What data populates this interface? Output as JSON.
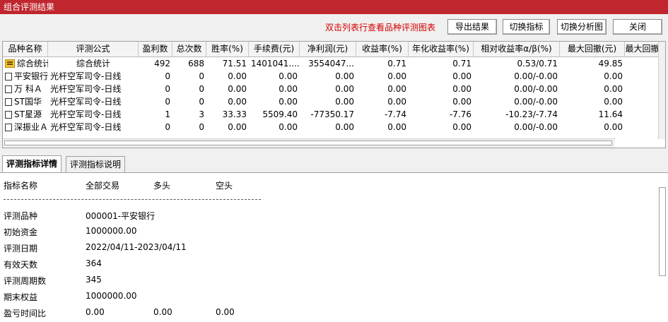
{
  "window": {
    "title": "组合评测结果"
  },
  "toolbar": {
    "hint": "双击列表行查看品种评测图表",
    "export_label": "导出结果",
    "switch_indicator_label": "切换指标",
    "switch_chart_label": "切换分析图",
    "close_label": "关闭"
  },
  "table": {
    "columns": [
      "品种名称",
      "评测公式",
      "盈利数",
      "总次数",
      "胜率(%)",
      "手续费(元)",
      "净利润(元)",
      "收益率(%)",
      "年化收益率(%)",
      "相对收益率α/β(%)",
      "最大回撤(元)",
      "最大回撤"
    ],
    "rows": [
      [
        "综合统计",
        "综合统计",
        "492",
        "688",
        "71.51",
        "1401041....",
        "3554047...",
        "0.71",
        "0.71",
        "0.53/0.71",
        "49.85",
        ""
      ],
      [
        "平安银行",
        "光杆空军司令-日线",
        "0",
        "0",
        "0.00",
        "0.00",
        "0.00",
        "0.00",
        "0.00",
        "0.00/-0.00",
        "0.00",
        ""
      ],
      [
        "万 科Ａ",
        "光杆空军司令-日线",
        "0",
        "0",
        "0.00",
        "0.00",
        "0.00",
        "0.00",
        "0.00",
        "0.00/-0.00",
        "0.00",
        ""
      ],
      [
        "ST国华",
        "光杆空军司令-日线",
        "0",
        "0",
        "0.00",
        "0.00",
        "0.00",
        "0.00",
        "0.00",
        "0.00/-0.00",
        "0.00",
        ""
      ],
      [
        "ST星源",
        "光杆空军司令-日线",
        "1",
        "3",
        "33.33",
        "5509.40",
        "-77350.17",
        "-7.74",
        "-7.76",
        "-10.23/-7.74",
        "11.64",
        ""
      ],
      [
        "深振业Ａ",
        "光杆空军司令-日线",
        "0",
        "0",
        "0.00",
        "0.00",
        "0.00",
        "0.00",
        "0.00",
        "0.00/-0.00",
        "0.00",
        ""
      ]
    ]
  },
  "tabs": [
    {
      "label": "评测指标详情"
    },
    {
      "label": "评测指标说明"
    }
  ],
  "detail": {
    "headers": [
      "指标名称",
      "全部交易",
      "多头",
      "空头"
    ],
    "divider": "------------------------------------------------------------",
    "rows": [
      [
        "评测品种",
        "000001-平安银行",
        "",
        ""
      ],
      [
        "初始资金",
        "1000000.00",
        "",
        ""
      ],
      [
        "评测日期",
        "2022/04/11-2023/04/11",
        "",
        ""
      ],
      [
        "有效天数",
        "364",
        "",
        ""
      ],
      [
        "评测周期数",
        " 345",
        "",
        ""
      ],
      [
        "期末权益",
        "1000000.00",
        "",
        ""
      ],
      [
        "盈亏时间比",
        " 0.00",
        "0.00",
        "0.00"
      ]
    ]
  }
}
